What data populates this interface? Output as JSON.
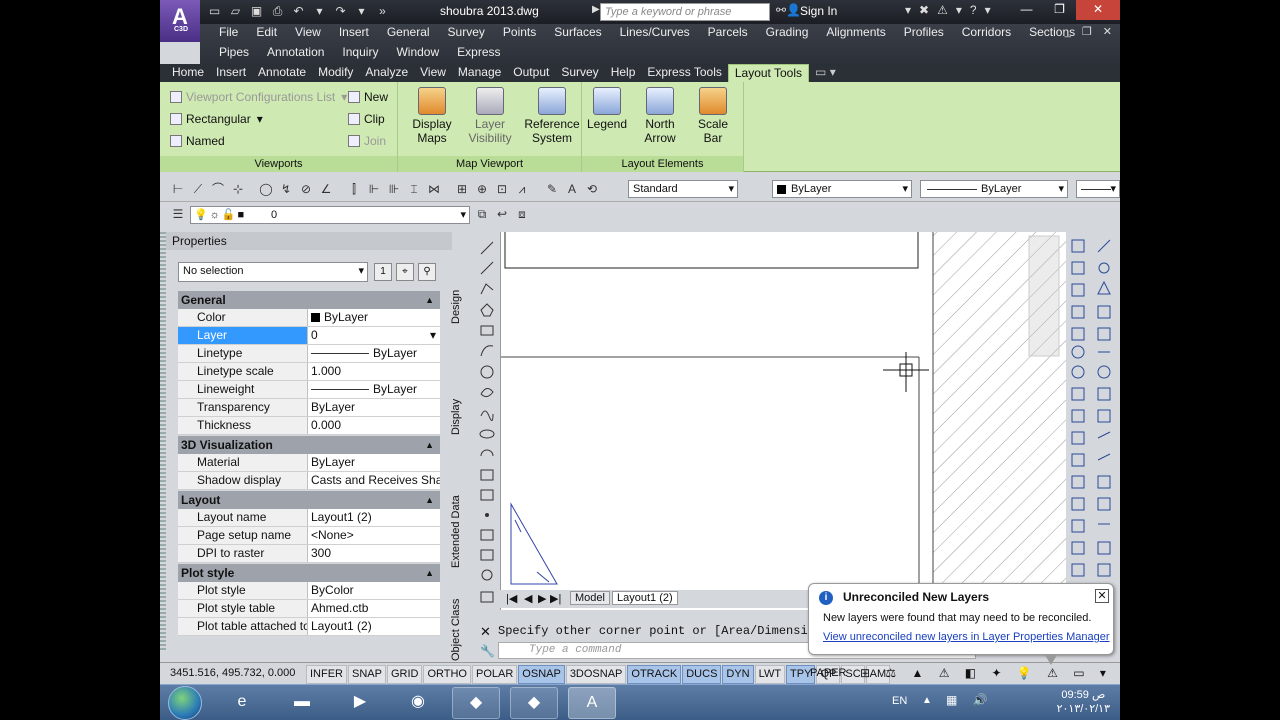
{
  "window": {
    "doc_title": "shoubra 2013.dwg",
    "app_logo": "A",
    "app_logo_sub": "C3D",
    "search_placeholder": "Type a keyword or phrase",
    "sign_in": "Sign In"
  },
  "menu": {
    "row1": [
      "File",
      "Edit",
      "View",
      "Insert",
      "General",
      "Survey",
      "Points",
      "Surfaces",
      "Lines/Curves",
      "Parcels",
      "Grading",
      "Alignments",
      "Profiles",
      "Corridors",
      "Sections"
    ],
    "row2": [
      "Pipes",
      "Annotation",
      "Inquiry",
      "Window",
      "Express"
    ]
  },
  "ribbon_tabs": [
    "Home",
    "Insert",
    "Annotate",
    "Modify",
    "Analyze",
    "View",
    "Manage",
    "Output",
    "Survey",
    "Help",
    "Express Tools",
    "Layout Tools"
  ],
  "ribbon": {
    "viewports": {
      "title": "Viewports",
      "config_list": "Viewport Configurations List",
      "new": "New",
      "rectangular": "Rectangular",
      "clip": "Clip",
      "named": "Named",
      "join": "Join"
    },
    "map_viewport": {
      "title": "Map Viewport",
      "display_maps_1": "Display",
      "display_maps_2": "Maps",
      "layer_visibility_1": "Layer",
      "layer_visibility_2": "Visibility",
      "reference_system_1": "Reference",
      "reference_system_2": "System"
    },
    "layout_elements": {
      "title": "Layout Elements",
      "legend": "Legend",
      "north_arrow_1": "North",
      "north_arrow_2": "Arrow",
      "scale_bar_1": "Scale",
      "scale_bar_2": "Bar"
    }
  },
  "toolbar": {
    "text_style": "Standard",
    "color": "ByLayer",
    "linetype": "ByLayer",
    "layer": "0"
  },
  "properties": {
    "title": "Properties",
    "selection": "No selection",
    "categories": [
      {
        "name": "General",
        "rows": [
          {
            "k": "Color",
            "v": "ByLayer"
          },
          {
            "k": "Layer",
            "v": "0"
          },
          {
            "k": "Linetype",
            "v": "ByLayer"
          },
          {
            "k": "Linetype scale",
            "v": "1.000"
          },
          {
            "k": "Lineweight",
            "v": "ByLayer"
          },
          {
            "k": "Transparency",
            "v": "ByLayer"
          },
          {
            "k": "Thickness",
            "v": "0.000"
          }
        ]
      },
      {
        "name": "3D Visualization",
        "rows": [
          {
            "k": "Material",
            "v": "ByLayer"
          },
          {
            "k": "Shadow display",
            "v": "Casts and Receives Shad..."
          }
        ]
      },
      {
        "name": "Layout",
        "rows": [
          {
            "k": "Layout name",
            "v": "Layout1 (2)"
          },
          {
            "k": "Page setup name",
            "v": "<None>"
          },
          {
            "k": "DPI to raster",
            "v": "300"
          }
        ]
      },
      {
        "name": "Plot style",
        "rows": [
          {
            "k": "Plot style",
            "v": "ByColor"
          },
          {
            "k": "Plot style table",
            "v": "Ahmed.ctb"
          },
          {
            "k": "Plot table attached to",
            "v": "Layout1 (2)"
          }
        ]
      }
    ],
    "side_tabs": [
      "Design",
      "Display",
      "Extended Data",
      "Object Class"
    ]
  },
  "layout_tabs": {
    "model": "Model",
    "layout": "Layout1 (2)"
  },
  "command": {
    "history": "Specify other corner point or [Area/Dimensions/",
    "placeholder": "Type a command"
  },
  "balloon": {
    "title": "Unreconciled New Layers",
    "message": "New layers were found that may need to be reconciled.",
    "link": "View unreconciled new layers in Layer Properties Manager"
  },
  "status": {
    "coords": "3451.516, 495.732, 0.000",
    "buttons": [
      {
        "label": "INFER",
        "on": false
      },
      {
        "label": "SNAP",
        "on": false
      },
      {
        "label": "GRID",
        "on": false
      },
      {
        "label": "ORTHO",
        "on": false
      },
      {
        "label": "POLAR",
        "on": false
      },
      {
        "label": "OSNAP",
        "on": true
      },
      {
        "label": "3DOSNAP",
        "on": false
      },
      {
        "label": "OTRACK",
        "on": true
      },
      {
        "label": "DUCS",
        "on": true
      },
      {
        "label": "DYN",
        "on": true
      },
      {
        "label": "LWT",
        "on": false
      },
      {
        "label": "TPY",
        "on": true
      },
      {
        "label": "QP",
        "on": false
      },
      {
        "label": "SC",
        "on": false
      },
      {
        "label": "AM",
        "on": false
      }
    ],
    "paper": "PAPER"
  },
  "taskbar": {
    "lang": "EN",
    "time": "09:59 ص",
    "date": "٢٠١٣/٠٢/١٣"
  }
}
